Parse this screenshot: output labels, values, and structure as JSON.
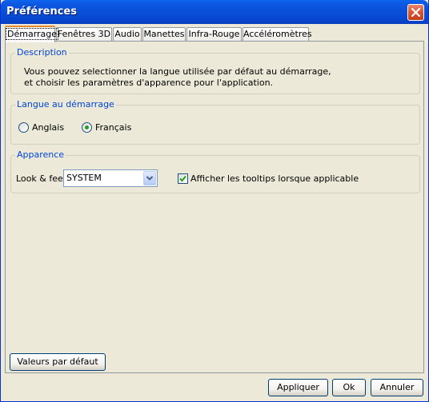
{
  "window": {
    "title": "Préférences",
    "close_icon": "close-icon"
  },
  "tabs": [
    {
      "label": "Démarrage"
    },
    {
      "label": "Fenêtres 3D"
    },
    {
      "label": "Audio"
    },
    {
      "label": "Manettes"
    },
    {
      "label": "Infra-Rouge"
    },
    {
      "label": "Accéléromètres"
    }
  ],
  "description": {
    "title": "Description",
    "line1": "Vous pouvez selectionner la langue utilisée par défaut au démarrage,",
    "line2": "et choisir les paramètres d'apparence pour l'application."
  },
  "language": {
    "title": "Langue au démarrage",
    "options": [
      {
        "label": "Anglais",
        "selected": false
      },
      {
        "label": "Français",
        "selected": true
      }
    ]
  },
  "appearance": {
    "title": "Apparence",
    "look_label": "Look & feel",
    "look_value": "SYSTEM",
    "tooltips_label": "Afficher les tooltips lorsque applicable",
    "tooltips_checked": true
  },
  "buttons": {
    "defaults": "Valeurs par défaut",
    "apply": "Appliquer",
    "ok": "Ok",
    "cancel": "Annuler"
  },
  "colors": {
    "title_bar": "#0a4fd8",
    "group_title": "#0046d5",
    "dialog_bg": "#ece9d8",
    "active_tab_accent": "#e68b2c"
  }
}
